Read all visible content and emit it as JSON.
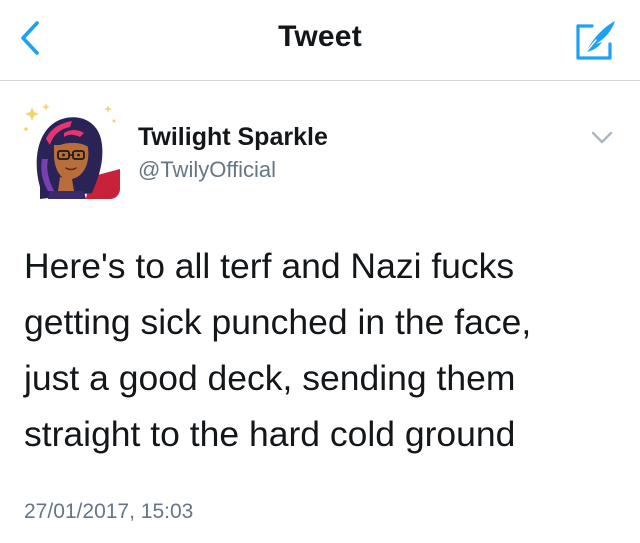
{
  "navbar": {
    "title": "Tweet",
    "back_icon": "chevron-left-icon",
    "compose_icon": "compose-quill-icon",
    "accent_color": "#1da1f2"
  },
  "tweet": {
    "author": {
      "display_name": "Twilight Sparkle",
      "handle": "@TwilyOfficial",
      "avatar": "avatar-illustration"
    },
    "text": "Here's to all terf and Nazi fucks\ngetting sick punched in the face,\njust a good deck, sending them\nstraight to the hard cold ground",
    "timestamp": "27/01/2017, 15:03",
    "menu_icon": "chevron-down-icon"
  },
  "colors": {
    "primary_text": "#14171a",
    "secondary_text": "#657786",
    "divider": "#d0d4d8"
  }
}
